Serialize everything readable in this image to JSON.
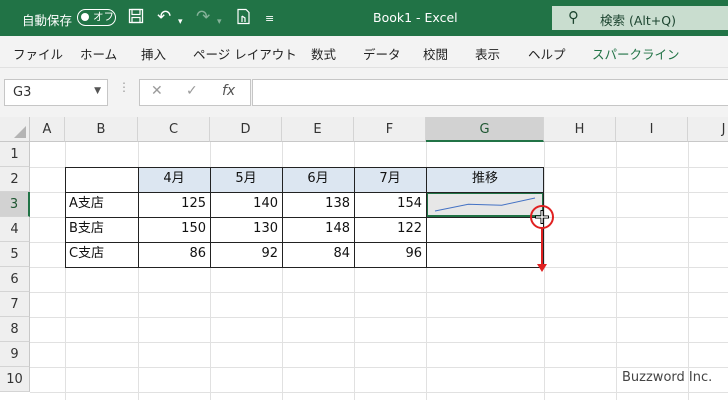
{
  "titlebar": {
    "autosave_label": "自動保存",
    "autosave_state": "オフ",
    "title": "Book1  -  Excel",
    "search_placeholder": "検索 (Alt+Q)",
    "bg_color": "#217346",
    "icons": [
      "save-icon",
      "undo-icon",
      "redo-icon",
      "touch-mode-icon",
      "customize-toolbar-icon"
    ]
  },
  "ribbon": {
    "tabs": [
      "ファイル",
      "ホーム",
      "挿入",
      "ページ レイアウト",
      "数式",
      "データ",
      "校閲",
      "表示",
      "ヘルプ",
      "スパークライン"
    ],
    "active_tab": "スパークライン"
  },
  "formula_bar": {
    "name_box": "G3",
    "formula": ""
  },
  "grid": {
    "columns": [
      "A",
      "B",
      "C",
      "D",
      "E",
      "F",
      "G",
      "H",
      "I",
      "J"
    ],
    "rows": [
      "1",
      "2",
      "3",
      "4",
      "5",
      "6",
      "7",
      "8",
      "9",
      "10"
    ],
    "selected_column": "G",
    "selected_row": "3",
    "header_fill": "#dce6f1"
  },
  "table": {
    "headers": [
      "",
      "4月",
      "5月",
      "6月",
      "7月",
      "推移"
    ],
    "rows": [
      {
        "name": "A支店",
        "values": [
          "125",
          "140",
          "138",
          "154"
        ]
      },
      {
        "name": "B支店",
        "values": [
          "150",
          "130",
          "148",
          "122"
        ]
      },
      {
        "name": "C支店",
        "values": [
          "86",
          "92",
          "84",
          "96"
        ]
      }
    ]
  },
  "sparkline": {
    "series": [
      125,
      140,
      138,
      154
    ],
    "color": "#4472c4"
  },
  "annotation": {
    "drag_note": "fill handle dragged down from G3 to G5",
    "color": "#e02020"
  },
  "watermark": "Buzzword Inc."
}
